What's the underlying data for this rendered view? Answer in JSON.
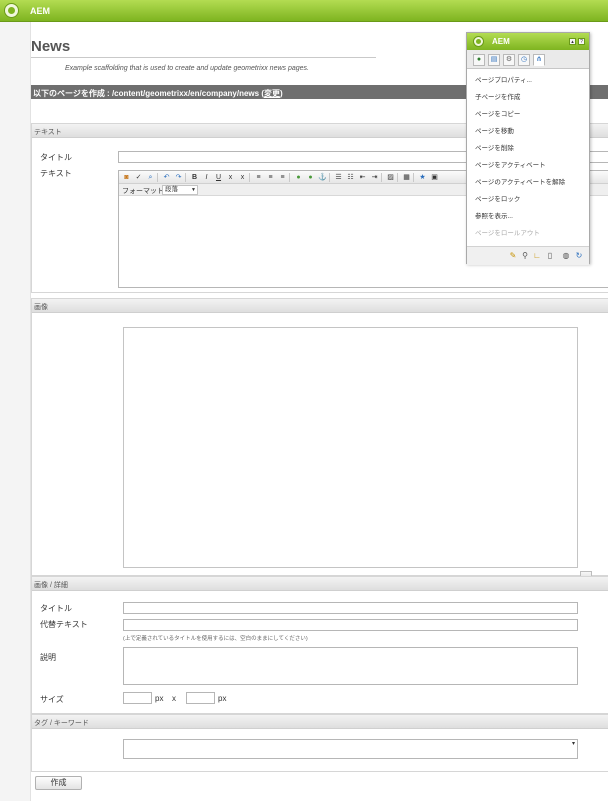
{
  "app": {
    "title": "AEM"
  },
  "page": {
    "title": "News",
    "description": "Example scaffolding that is used to create and update geometrixx news pages.",
    "path_prefix": "以下のページを作成 : /content/geometrixx/en/company/news",
    "path_change_link": "変更"
  },
  "text_section": {
    "header": "テキスト",
    "title_label": "タイトル",
    "text_label": "テキスト",
    "toolbar_icons": [
      "source-edit-icon",
      "spellcheck-icon",
      "find-replace-icon",
      "undo-icon",
      "redo-icon",
      "bold-icon",
      "italic-icon",
      "underline-icon",
      "subscript-icon",
      "superscript-icon",
      "align-left-icon",
      "align-center-icon",
      "align-right-icon",
      "link-icon",
      "unlink-icon",
      "anchor-icon",
      "bullet-list-icon",
      "numbered-list-icon",
      "outdent-icon",
      "indent-icon",
      "paste-icon",
      "table-icon",
      "special-char-icon",
      "image-icon"
    ],
    "format_label": "フォーマット",
    "format_value": "段落"
  },
  "image_section": {
    "header": "画像"
  },
  "image_detail_section": {
    "header": "画像 / 詳細",
    "title_label": "タイトル",
    "alt_label": "代替テキスト",
    "alt_note": "(上で定義されているタイトルを使用するには、空白のままにしてください)",
    "desc_label": "説明",
    "size_label": "サイズ",
    "px_unit": "px",
    "times": "x"
  },
  "tags_section": {
    "header": "タグ / キーワード"
  },
  "create_button": "作成",
  "sidekick": {
    "title": "AEM",
    "items": [
      {
        "label": "ページプロパティ...",
        "enabled": true
      },
      {
        "label": "子ページを作成",
        "enabled": true
      },
      {
        "label": "ページをコピー",
        "enabled": true
      },
      {
        "label": "ページを移動",
        "enabled": true
      },
      {
        "label": "ページを削除",
        "enabled": true
      },
      {
        "label": "ページをアクティベート",
        "enabled": true
      },
      {
        "label": "ページのアクティベートを解除",
        "enabled": true
      },
      {
        "label": "ページをロック",
        "enabled": true
      },
      {
        "label": "参照を表示...",
        "enabled": true
      },
      {
        "label": "ページをロールアウト",
        "enabled": false
      }
    ]
  }
}
